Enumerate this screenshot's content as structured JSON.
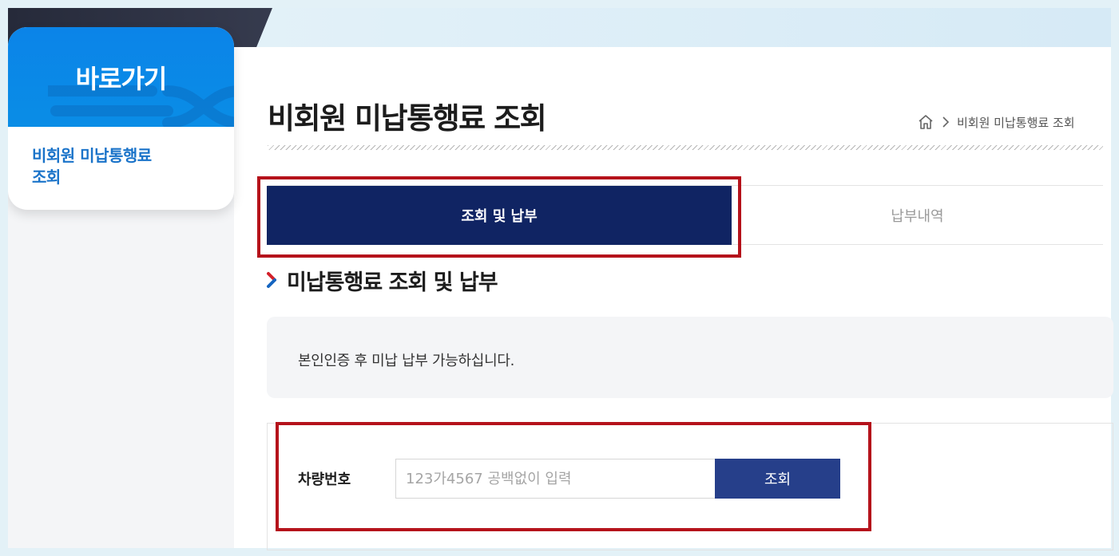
{
  "sidebar": {
    "title": "바로가기",
    "items": [
      {
        "label_line1": "비회원 미납통행료",
        "label_line2": "조회"
      }
    ]
  },
  "header": {
    "page_title": "비회원 미납통행료 조회",
    "breadcrumb": {
      "home_icon": "home-icon",
      "separator_icon": "chevron-right-icon",
      "current": "비회원 미납통행료 조회"
    }
  },
  "tabs": [
    {
      "label": "조회 및 납부",
      "active": true
    },
    {
      "label": "납부내역",
      "active": false
    }
  ],
  "section": {
    "title": "미납통행료 조회 및 납부",
    "notice": "본인인증 후 미납 납부 가능하십니다."
  },
  "form": {
    "plate_label": "차량번호",
    "plate_placeholder": "123가4567 공백없이 입력",
    "plate_value": "",
    "search_label": "조회"
  },
  "colors": {
    "brand_navy": "#102463",
    "button_blue": "#263f8a",
    "sidebar_blue": "#0b84e8",
    "link_blue": "#1a73c9",
    "highlight_red": "#b5121b"
  }
}
